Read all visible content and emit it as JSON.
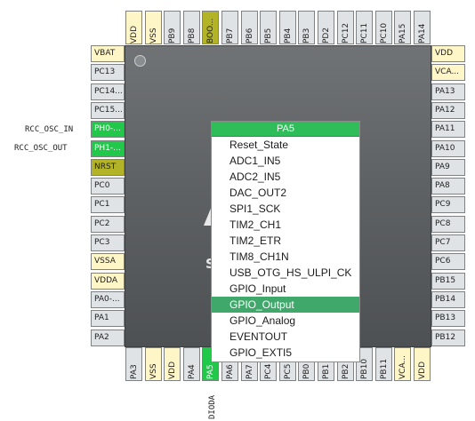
{
  "chip": {
    "logo_letter": "S"
  },
  "pins": {
    "top": [
      {
        "label": "VDD",
        "type": "power"
      },
      {
        "label": "VSS",
        "type": "power"
      },
      {
        "label": "PB9",
        "type": "io"
      },
      {
        "label": "PB8",
        "type": "io"
      },
      {
        "label": "BOO...",
        "type": "boot"
      },
      {
        "label": "PB7",
        "type": "io"
      },
      {
        "label": "PB6",
        "type": "io"
      },
      {
        "label": "PB5",
        "type": "io"
      },
      {
        "label": "PB4",
        "type": "io"
      },
      {
        "label": "PB3",
        "type": "io"
      },
      {
        "label": "PD2",
        "type": "io"
      },
      {
        "label": "PC12",
        "type": "io"
      },
      {
        "label": "PC11",
        "type": "io"
      },
      {
        "label": "PC10",
        "type": "io"
      },
      {
        "label": "PA15",
        "type": "io"
      },
      {
        "label": "PA14",
        "type": "io"
      }
    ],
    "left": [
      {
        "label": "VBAT",
        "type": "power"
      },
      {
        "label": "PC13",
        "type": "io"
      },
      {
        "label": "PC14...",
        "type": "io"
      },
      {
        "label": "PC15...",
        "type": "io"
      },
      {
        "label": "PH0-...",
        "type": "active"
      },
      {
        "label": "PH1-...",
        "type": "active"
      },
      {
        "label": "NRST",
        "type": "boot"
      },
      {
        "label": "PC0",
        "type": "io"
      },
      {
        "label": "PC1",
        "type": "io"
      },
      {
        "label": "PC2",
        "type": "io"
      },
      {
        "label": "PC3",
        "type": "io"
      },
      {
        "label": "VSSA",
        "type": "power"
      },
      {
        "label": "VDDA",
        "type": "power"
      },
      {
        "label": "PA0-...",
        "type": "io"
      },
      {
        "label": "PA1",
        "type": "io"
      },
      {
        "label": "PA2",
        "type": "io"
      }
    ],
    "right": [
      {
        "label": "VDD",
        "type": "power"
      },
      {
        "label": "VCA...",
        "type": "power"
      },
      {
        "label": "PA13",
        "type": "io"
      },
      {
        "label": "PA12",
        "type": "io"
      },
      {
        "label": "PA11",
        "type": "io"
      },
      {
        "label": "PA10",
        "type": "io"
      },
      {
        "label": "PA9",
        "type": "io"
      },
      {
        "label": "PA8",
        "type": "io"
      },
      {
        "label": "PC9",
        "type": "io"
      },
      {
        "label": "PC8",
        "type": "io"
      },
      {
        "label": "PC7",
        "type": "io"
      },
      {
        "label": "PC6",
        "type": "io"
      },
      {
        "label": "PB15",
        "type": "io"
      },
      {
        "label": "PB14",
        "type": "io"
      },
      {
        "label": "PB13",
        "type": "io"
      },
      {
        "label": "PB12",
        "type": "io"
      }
    ],
    "bottom": [
      {
        "label": "PA3",
        "type": "io"
      },
      {
        "label": "VSS",
        "type": "power"
      },
      {
        "label": "VDD",
        "type": "power"
      },
      {
        "label": "PA4",
        "type": "io"
      },
      {
        "label": "PA5",
        "type": "active"
      },
      {
        "label": "PA6",
        "type": "io"
      },
      {
        "label": "PA7",
        "type": "io"
      },
      {
        "label": "PC4",
        "type": "io"
      },
      {
        "label": "PC5",
        "type": "io"
      },
      {
        "label": "PB0",
        "type": "io"
      },
      {
        "label": "PB1",
        "type": "io"
      },
      {
        "label": "PB2",
        "type": "io"
      },
      {
        "label": "PB10",
        "type": "io"
      },
      {
        "label": "PB11",
        "type": "io"
      },
      {
        "label": "VCA...",
        "type": "power"
      },
      {
        "label": "VDD",
        "type": "power"
      }
    ]
  },
  "signal_labels": {
    "ph0": "RCC_OSC_IN",
    "ph1": "RCC_OSC_OUT",
    "pa5": "DIODA"
  },
  "menu": {
    "title": "PA5",
    "selected_index": 10,
    "items": [
      "Reset_State",
      "ADC1_IN5",
      "ADC2_IN5",
      "DAC_OUT2",
      "SPI1_SCK",
      "TIM2_CH1",
      "TIM2_ETR",
      "TIM8_CH1N",
      "USB_OTG_HS_ULPI_CK",
      "GPIO_Input",
      "GPIO_Output",
      "GPIO_Analog",
      "EVENTOUT",
      "GPIO_EXTI5"
    ]
  },
  "colors": {
    "active_pin": "#22c84a",
    "power_pin": "#fff6c7",
    "boot_pin": "#b3b327",
    "io_pin": "#dfe3e6",
    "menu_header": "#2fbd5a",
    "menu_selected": "#3fa86a"
  }
}
